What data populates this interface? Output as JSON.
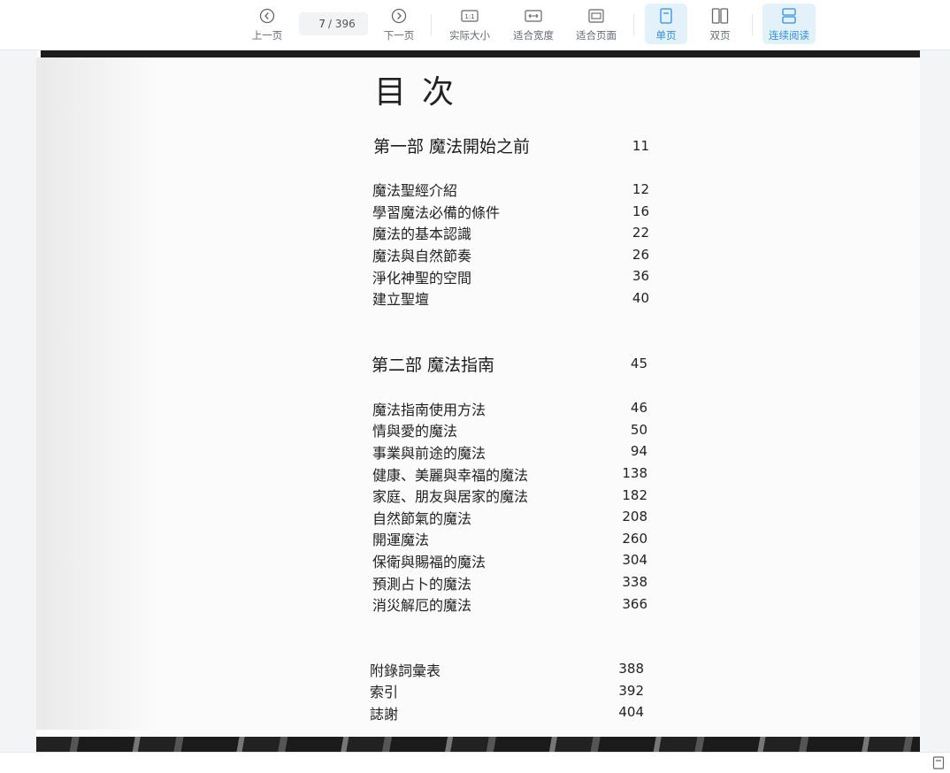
{
  "toolbar": {
    "prev_label": "上一页",
    "next_label": "下一页",
    "current_page": "7",
    "total_pages": "/ 396",
    "actual_size_label": "实际大小",
    "fit_width_label": "适合宽度",
    "fit_page_label": "适合页面",
    "single_page_label": "单页",
    "double_page_label": "双页",
    "continuous_label": "连续阅读",
    "actual_size_icon_text": "1:1",
    "active_color": "#2f8fe0",
    "active_bg": "#e3f1fb"
  },
  "document": {
    "title": "目次",
    "sections": [
      {
        "heading": "第一部  魔法開始之前",
        "page": "11",
        "entries": [
          {
            "title": "魔法聖經介紹",
            "page": "12"
          },
          {
            "title": "學習魔法必備的條件",
            "page": "16"
          },
          {
            "title": "魔法的基本認識",
            "page": "22"
          },
          {
            "title": "魔法與自然節奏",
            "page": "26"
          },
          {
            "title": "淨化神聖的空間",
            "page": "36"
          },
          {
            "title": "建立聖壇",
            "page": "40"
          }
        ]
      },
      {
        "heading": "第二部  魔法指南",
        "page": "45",
        "entries": [
          {
            "title": "魔法指南使用方法",
            "page": "46"
          },
          {
            "title": "情與愛的魔法",
            "page": "50"
          },
          {
            "title": "事業與前途的魔法",
            "page": "94"
          },
          {
            "title": "健康、美麗與幸福的魔法",
            "page": "138"
          },
          {
            "title": "家庭、朋友與居家的魔法",
            "page": "182"
          },
          {
            "title": "自然節氣的魔法",
            "page": "208"
          },
          {
            "title": "開運魔法",
            "page": "260"
          },
          {
            "title": "保衛與賜福的魔法",
            "page": "304"
          },
          {
            "title": "預測占卜的魔法",
            "page": "338"
          },
          {
            "title": "消災解厄的魔法",
            "page": "366"
          }
        ]
      }
    ],
    "appendix": [
      {
        "title": "附錄詞彙表",
        "page": "388"
      },
      {
        "title": "索引",
        "page": "392"
      },
      {
        "title": "誌謝",
        "page": "404"
      }
    ]
  }
}
